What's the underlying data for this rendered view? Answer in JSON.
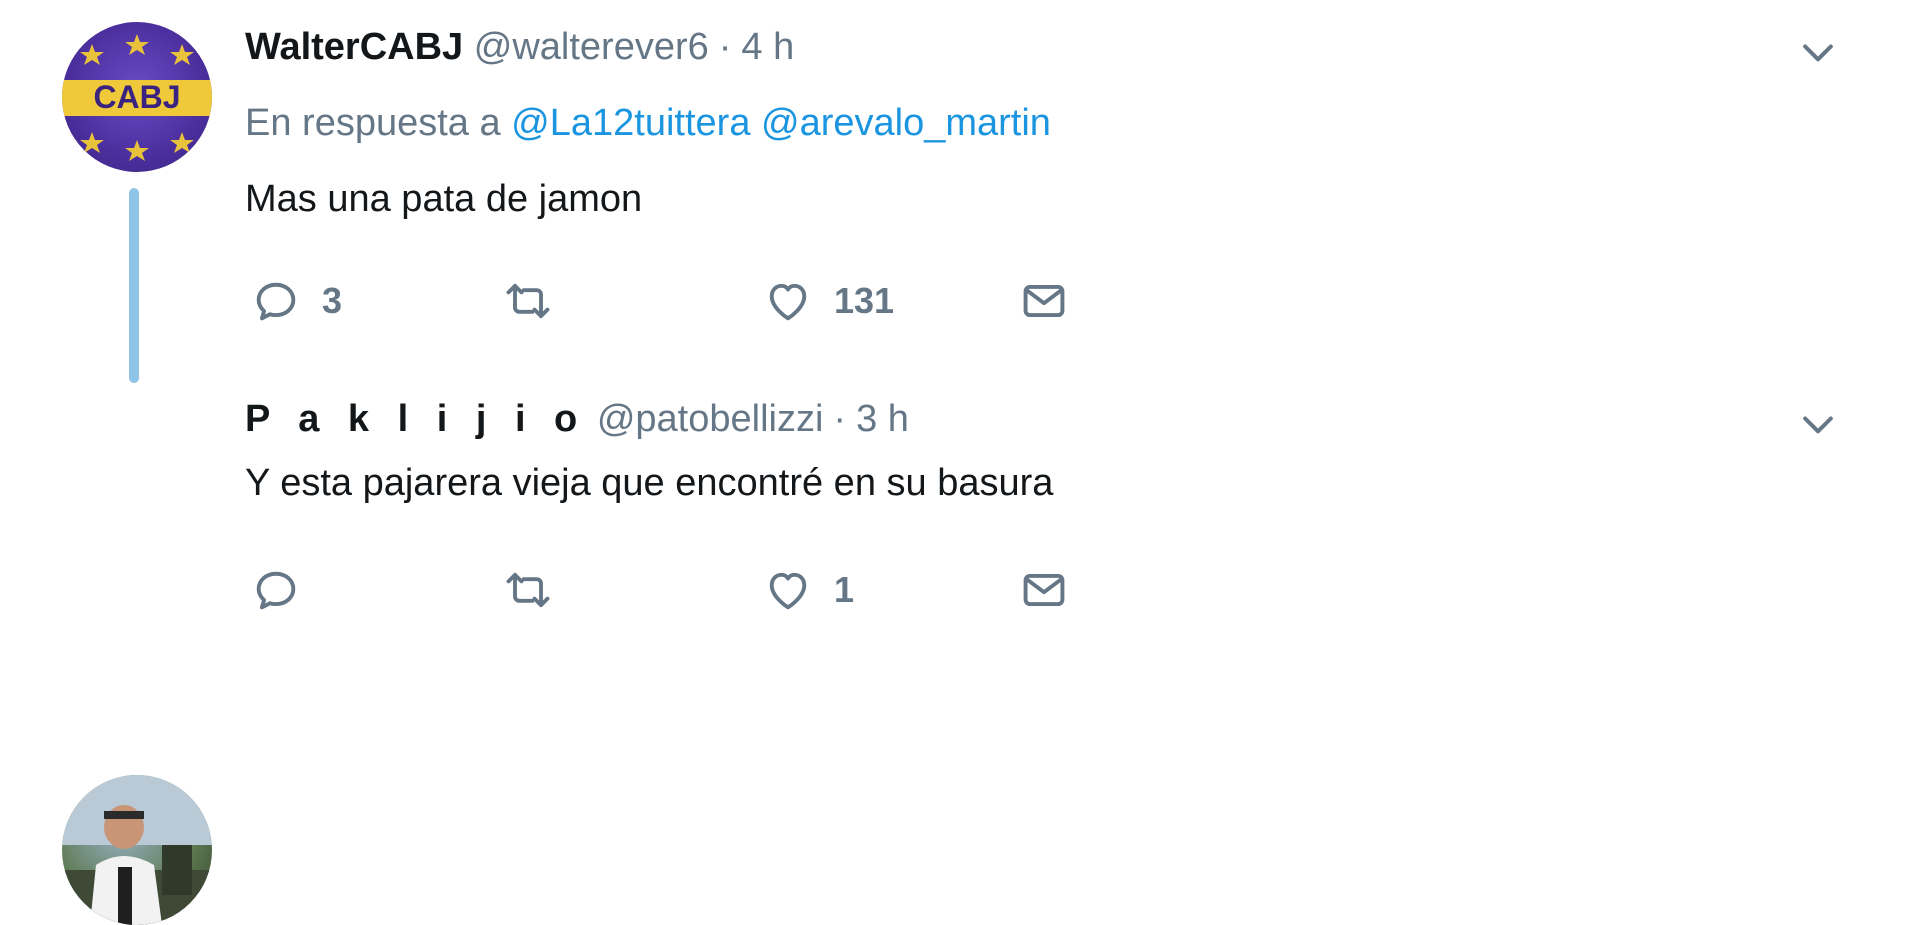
{
  "tweets": [
    {
      "name": "WalterCABJ",
      "handle": "@walterever6",
      "separator": "·",
      "time": "4 h",
      "reply_prefix": "En respuesta a",
      "mentions": [
        "@La12tuittera",
        "@arevalo_martin"
      ],
      "text": "Mas una pata de jamon",
      "reply_count": "3",
      "retweet_count": "",
      "like_count": "131",
      "avatar_text": "CABJ"
    },
    {
      "name": "P a k l i j i o",
      "handle": "@patobellizzi",
      "separator": "·",
      "time": "3 h",
      "text": "Y esta pajarera vieja que encontré en su basura",
      "reply_count": "",
      "retweet_count": "",
      "like_count": "1"
    }
  ],
  "icons": {
    "reply": "reply-icon",
    "retweet": "retweet-icon",
    "like": "heart-icon",
    "message": "envelope-icon",
    "menu": "chevron-down-icon"
  },
  "colors": {
    "link": "#1b95e0",
    "muted": "#657786",
    "text": "#14171a",
    "thread": "#8ec5e6",
    "avatar_1_bg": "#4b2f9e",
    "avatar_1_star": "#e8c23a"
  }
}
